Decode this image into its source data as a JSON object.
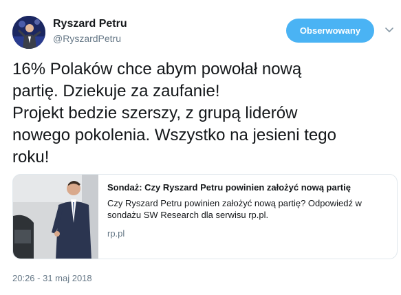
{
  "author": {
    "name": "Ryszard Petru",
    "handle": "@RyszardPetru"
  },
  "follow_button": {
    "label": "Obserwowany",
    "color": "#4ab3f4"
  },
  "caret_icon": "chevron-down-icon",
  "tweet": {
    "text": "16% Polaków chce abym powołał nową\npartię. Dziekuje za zaufanie!\nProjekt bedzie szerszy, z grupą liderów\nnowego pokolenia. Wszystko na jesieni tego\nroku!"
  },
  "card": {
    "title": "Sondaż: Czy Ryszard Petru powinien założyć nową partię",
    "description": "Czy Ryszard Petru powinien założyć nową partię? Odpowiedź w sondażu SW Research dla serwisu rp.pl.",
    "domain": "rp.pl"
  },
  "timestamp": "20:26 - 31 maj 2018",
  "colors": {
    "text_primary": "#14171a",
    "text_secondary": "#657786",
    "border": "#e1e8ed"
  }
}
